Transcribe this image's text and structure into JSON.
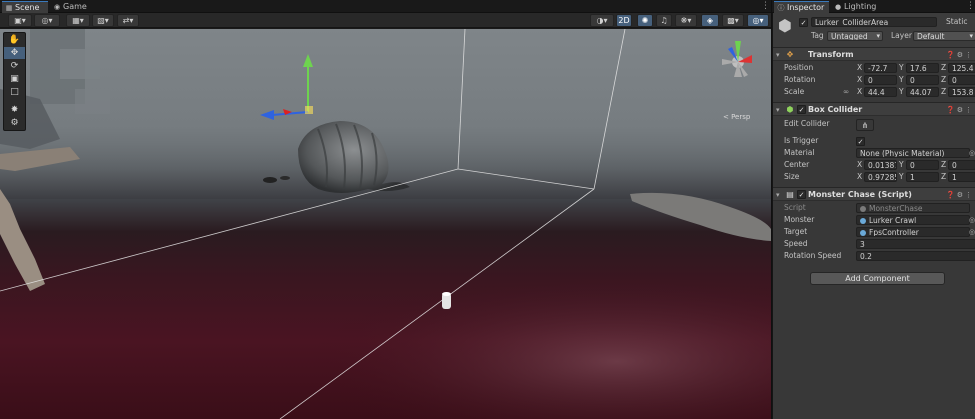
{
  "tabs": [
    {
      "label": "Scene",
      "icon": "grid-icon"
    },
    {
      "label": "Game",
      "icon": "gamepad-icon"
    }
  ],
  "inspector_tabs": [
    {
      "label": "Inspector",
      "icon": "info-icon"
    },
    {
      "label": "Lighting",
      "icon": "bulb-icon"
    }
  ],
  "toolbar": {
    "scale_value": "2D",
    "buttons": [
      "shading-mode",
      "render-mode",
      "gizmo-grid",
      "snap",
      "move-camera",
      "scene-lighting",
      "audio",
      "effects",
      "hidden-objects",
      "camera",
      "gizmos"
    ]
  },
  "scene": {
    "persp_label": "< Persp"
  },
  "object": {
    "name": "Lurker_ColliderArea",
    "active": true,
    "static_label": "Static",
    "tag_label": "Tag",
    "tag_value": "Untagged",
    "layer_label": "Layer",
    "layer_value": "Default"
  },
  "transform": {
    "title": "Transform",
    "position_label": "Position",
    "rotation_label": "Rotation",
    "scale_label": "Scale",
    "position": {
      "x": "-72.7",
      "y": "17.6",
      "z": "125.4"
    },
    "rotation": {
      "x": "0",
      "y": "0",
      "z": "0"
    },
    "scale": {
      "x": "44.4",
      "y": "44.07",
      "z": "153.8"
    }
  },
  "box_collider": {
    "title": "Box Collider",
    "enabled": true,
    "edit_collider_label": "Edit Collider",
    "is_trigger_label": "Is Trigger",
    "is_trigger": true,
    "material_label": "Material",
    "material_value": "None (Physic Material)",
    "center_label": "Center",
    "center": {
      "x": "0.01387",
      "y": "0",
      "z": "0"
    },
    "size_label": "Size",
    "size": {
      "x": "0.97285",
      "y": "1",
      "z": "1"
    }
  },
  "monster_chase": {
    "title": "Monster Chase (Script)",
    "enabled": true,
    "script_label": "Script",
    "script_value": "MonsterChase",
    "monster_label": "Monster",
    "monster_value": "Lurker Crawl",
    "target_label": "Target",
    "target_value": "FpsController",
    "speed_label": "Speed",
    "speed_value": "3",
    "rotation_speed_label": "Rotation Speed",
    "rotation_speed_value": "0.2"
  },
  "add_component_label": "Add Component",
  "axis_letters": {
    "x": "X",
    "y": "Y",
    "z": "Z"
  }
}
